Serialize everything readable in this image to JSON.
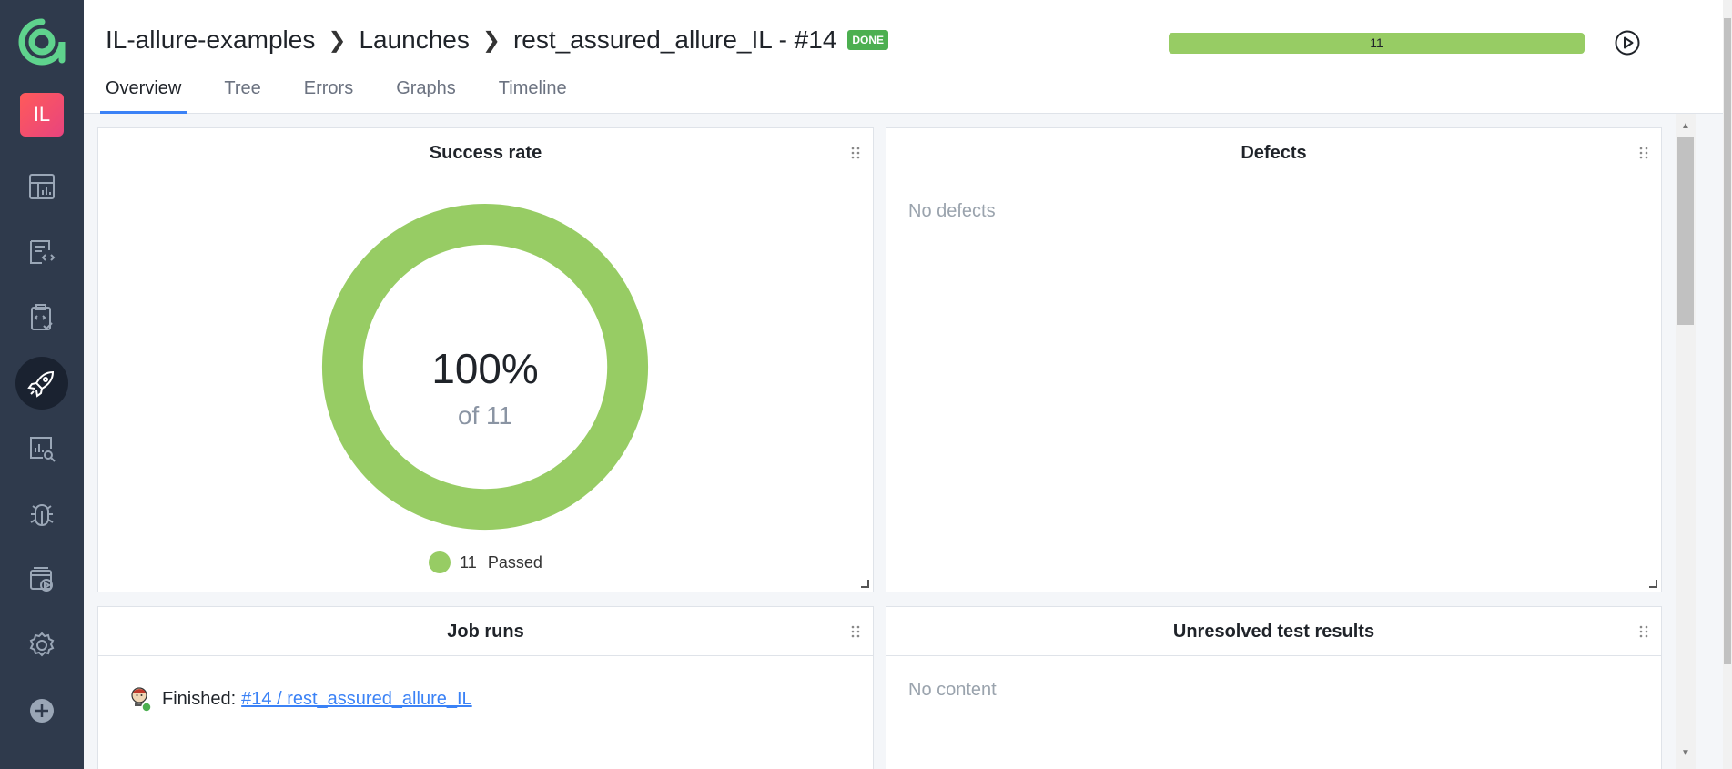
{
  "sidebar": {
    "avatar": "IL",
    "items": [
      {
        "name": "dashboards-icon"
      },
      {
        "name": "test-cases-icon"
      },
      {
        "name": "test-plans-icon"
      },
      {
        "name": "launches-icon"
      },
      {
        "name": "analytics-icon"
      },
      {
        "name": "defects-icon"
      },
      {
        "name": "jobs-icon"
      },
      {
        "name": "settings-icon"
      },
      {
        "name": "add-icon"
      }
    ]
  },
  "header": {
    "project": "IL-allure-examples",
    "section": "Launches",
    "launch": "rest_assured_allure_IL - #14",
    "status": "DONE",
    "progress_count": "11"
  },
  "tabs": [
    "Overview",
    "Tree",
    "Errors",
    "Graphs",
    "Timeline"
  ],
  "widgets": {
    "success_rate": {
      "title": "Success rate",
      "percent": "100%",
      "of": "of 11",
      "legend_count": "11",
      "legend_label": "Passed"
    },
    "defects": {
      "title": "Defects",
      "empty": "No defects"
    },
    "job_runs": {
      "title": "Job runs",
      "status": "Finished:",
      "link": "#14 / rest_assured_allure_IL"
    },
    "unresolved": {
      "title": "Unresolved test results",
      "empty": "No content"
    }
  },
  "colors": {
    "passed": "#97cc64",
    "accent": "#3b82f6",
    "sidebar": "#2f3a4c"
  }
}
